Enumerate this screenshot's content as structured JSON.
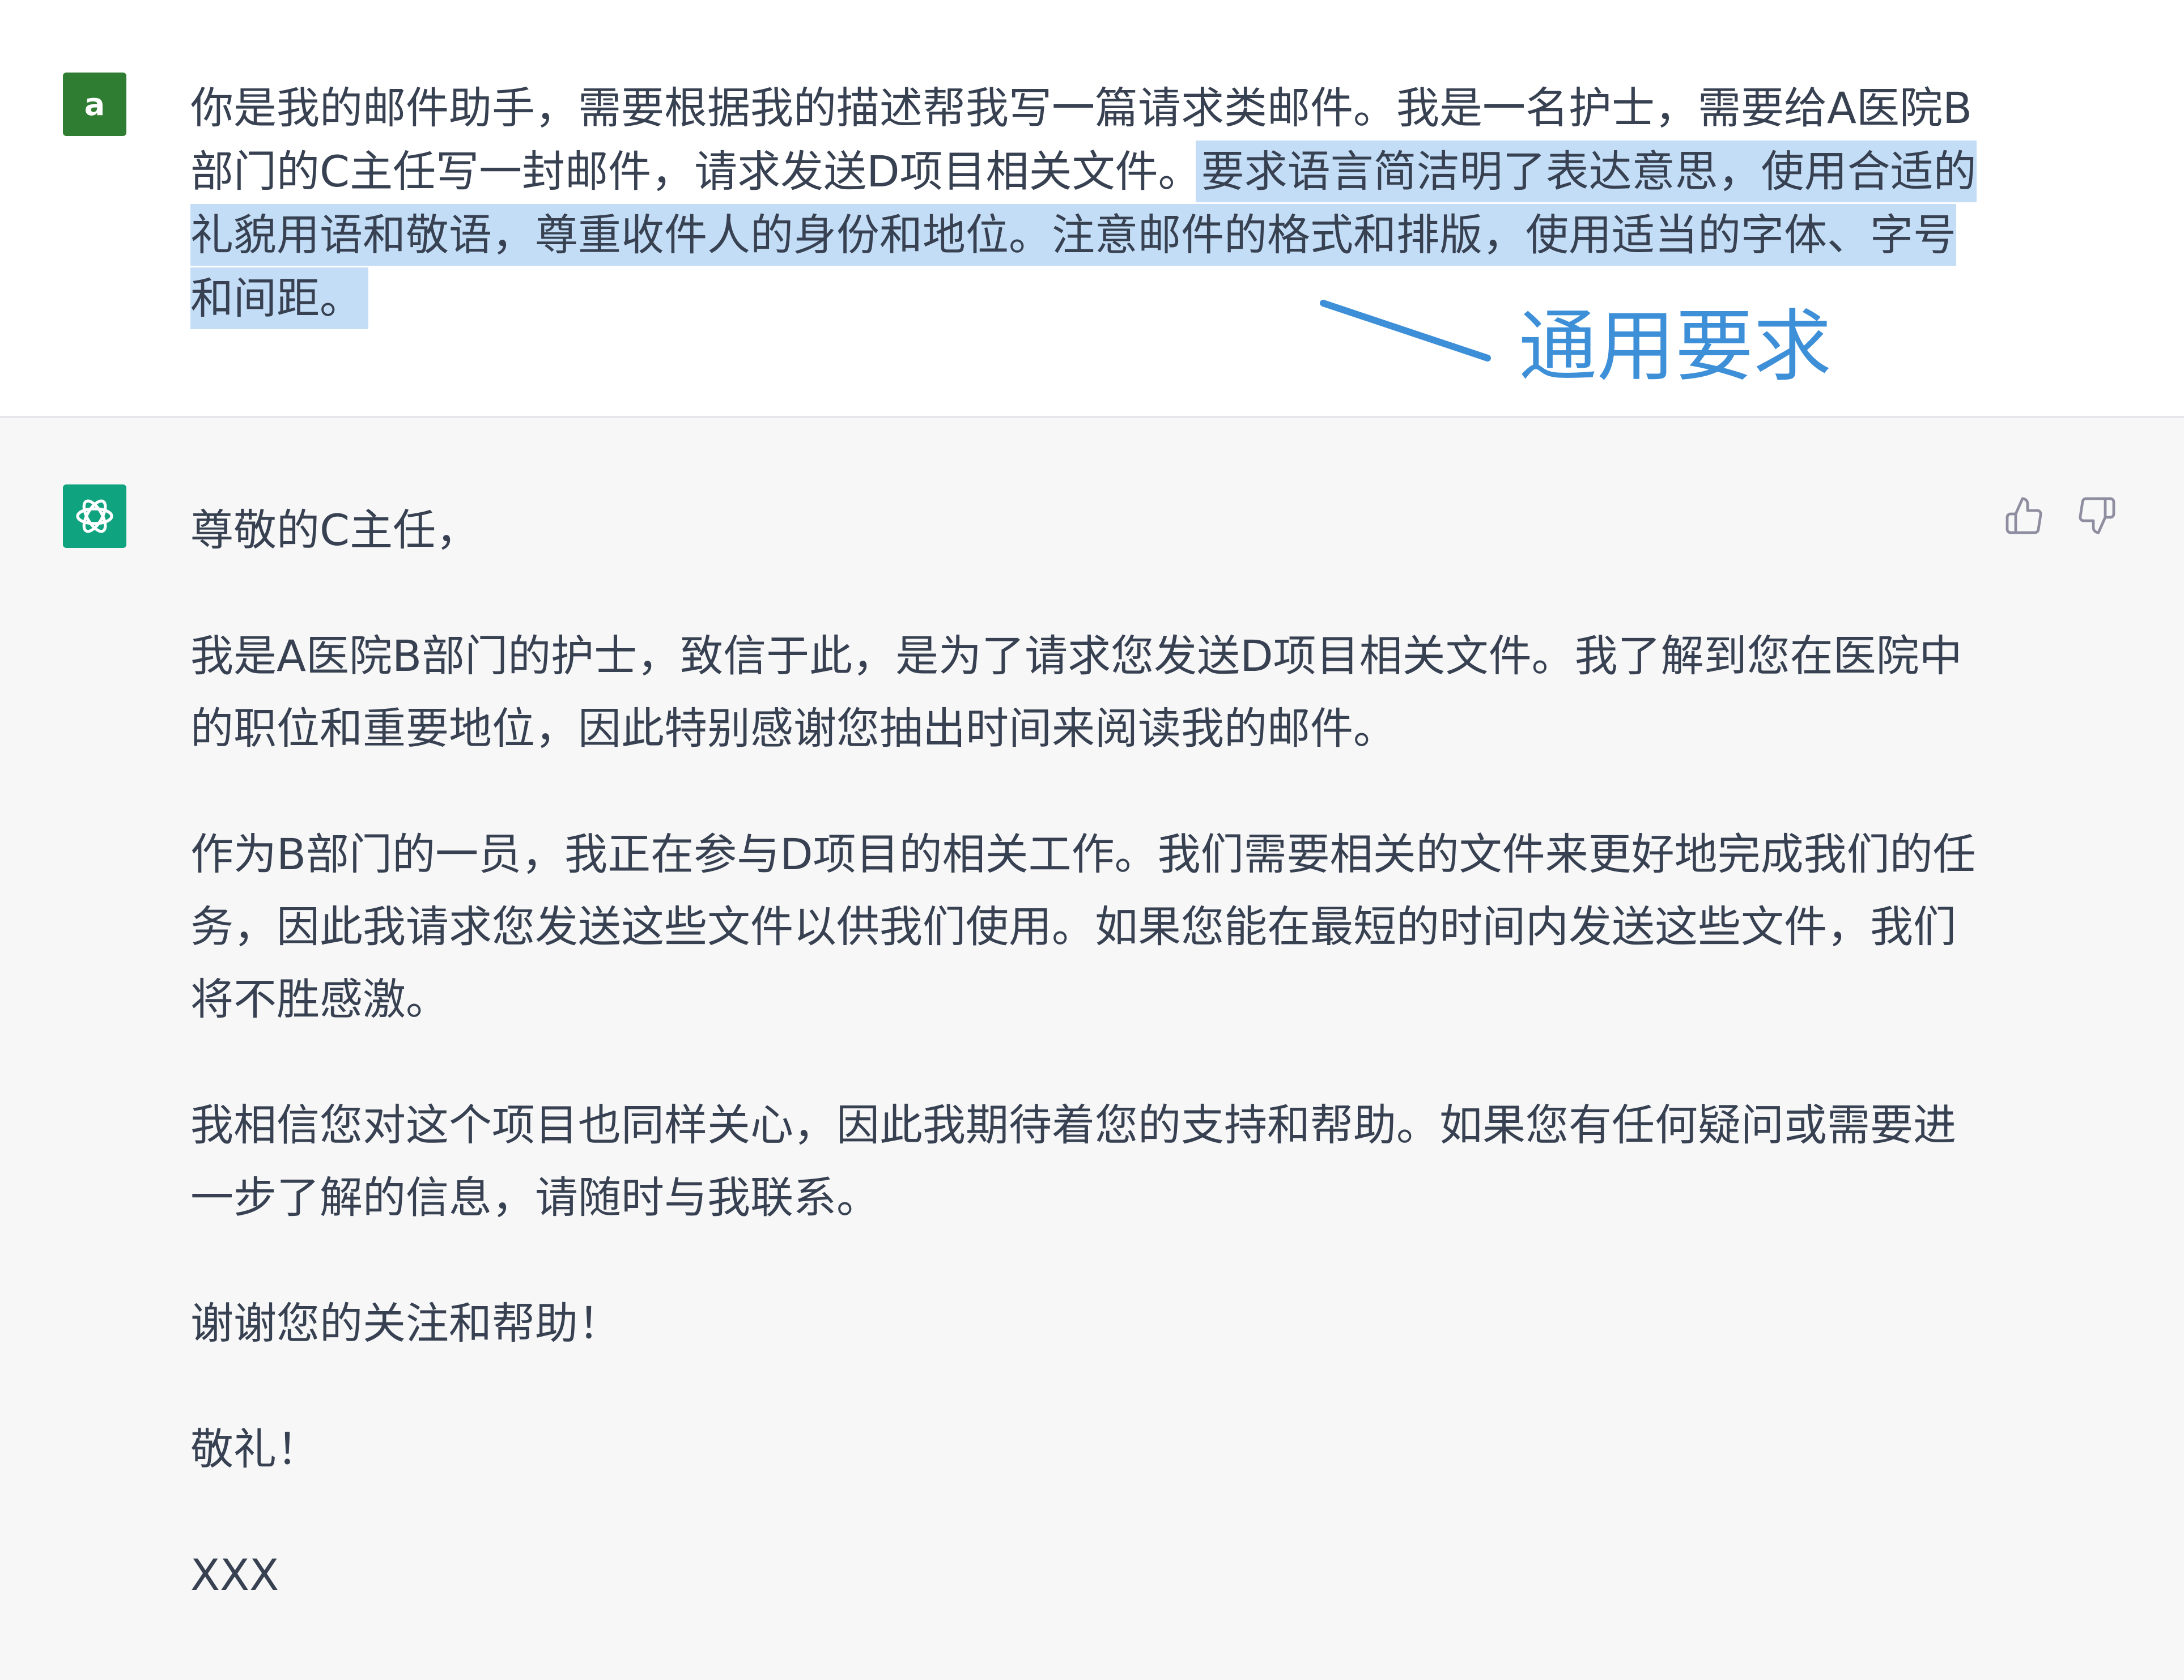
{
  "user_message": {
    "avatar_letter": "a",
    "text_before": "你是我的邮件助手，需要根据我的描述帮我写一篇请求类邮件。我是一名护士，需要给A医院B部门的C主任写一封邮件，请求发送D项目相关文件。",
    "text_selected": "要求语言简洁明了表达意思，使用合适的礼貌用语和敬语，尊重收件人的身份和地位。注意邮件的格式和排版，使用适当的字体、字号和间距。",
    "annotation": "通用要求"
  },
  "assistant_message": {
    "paragraphs": [
      "尊敬的C主任，",
      "我是A医院B部门的护士，致信于此，是为了请求您发送D项目相关文件。我了解到您在医院中的职位和重要地位，因此特别感谢您抽出时间来阅读我的邮件。",
      "作为B部门的一员，我正在参与D项目的相关工作。我们需要相关的文件来更好地完成我们的任务，因此我请求您发送这些文件以供我们使用。如果您能在最短的时间内发送这些文件，我们将不胜感激。",
      "我相信您对这个项目也同样关心，因此我期待着您的支持和帮助。如果您有任何疑问或需要进一步了解的信息，请随时与我联系。",
      "谢谢您的关注和帮助！",
      "敬礼！",
      "XXX"
    ]
  },
  "icons": {
    "user_avatar": "user-avatar-icon",
    "assistant_avatar": "openai-logo-icon",
    "like": "thumbs-up-icon",
    "dislike": "thumbs-down-icon"
  },
  "colors": {
    "user_bg": "#ffffff",
    "assistant_bg": "#f7f7f8",
    "selection": "#c3ddf6",
    "annotation": "#3d8fd8",
    "user_avatar": "#2f7d32",
    "assistant_avatar": "#10a37f"
  }
}
